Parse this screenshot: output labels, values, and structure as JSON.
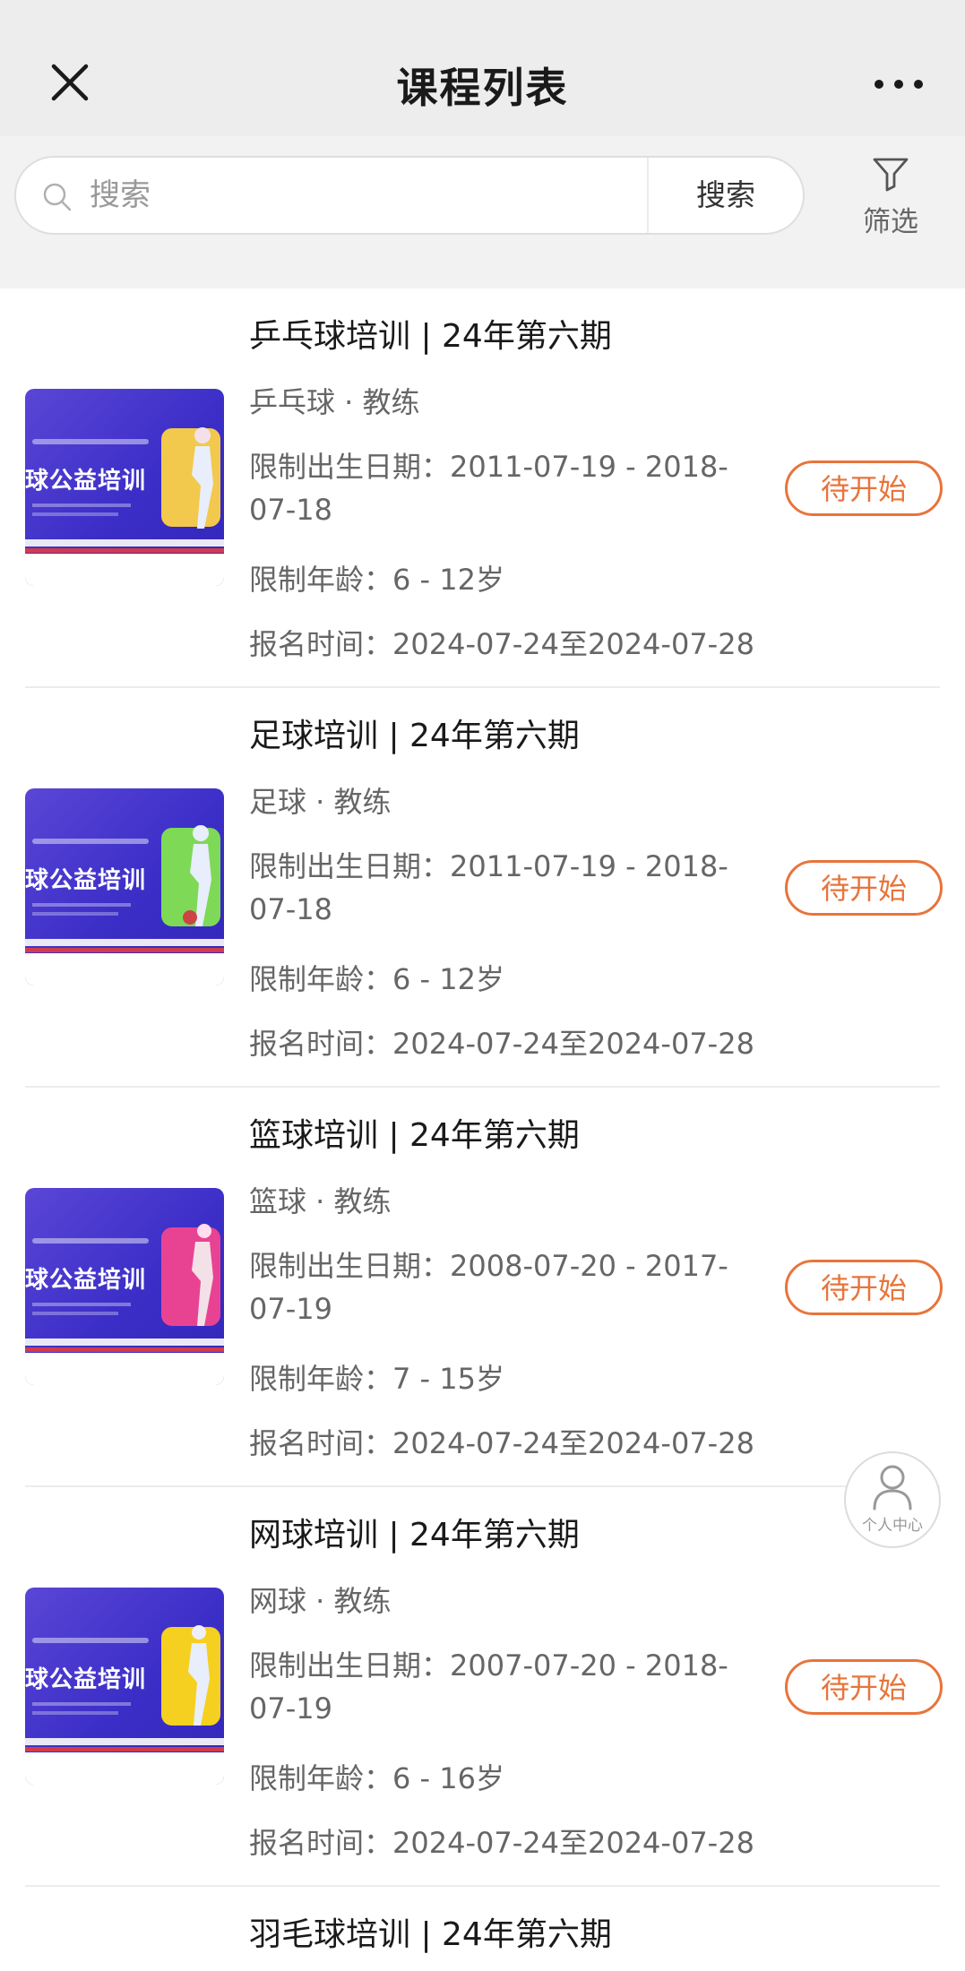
{
  "navbar": {
    "title": "课程列表"
  },
  "search": {
    "placeholder": "搜索",
    "button_label": "搜索",
    "filter_label": "筛选"
  },
  "courses": [
    {
      "title": "乒乓球培训 | 24年第六期",
      "subtitle": "乒乓球 · 教练",
      "birth_line1": "限制出生日期：2011-07-19 - 2018-",
      "birth_line2": "07-18",
      "age": "限制年龄：6 - 12岁",
      "registration": "报名时间：2024-07-24至2024-07-28",
      "status": "待开始",
      "thumb_text": "球公益培训",
      "thumb_accent": "#f2c94c"
    },
    {
      "title": "足球培训 | 24年第六期",
      "subtitle": "足球 · 教练",
      "birth_line1": "限制出生日期：2011-07-19 - 2018-",
      "birth_line2": "07-18",
      "age": "限制年龄：6 - 12岁",
      "registration": "报名时间：2024-07-24至2024-07-28",
      "status": "待开始",
      "thumb_text": "球公益培训",
      "thumb_accent": "#7ed957"
    },
    {
      "title": "篮球培训 | 24年第六期",
      "subtitle": "篮球 · 教练",
      "birth_line1": "限制出生日期：2008-07-20 - 2017-",
      "birth_line2": "07-19",
      "age": "限制年龄：7 - 15岁",
      "registration": "报名时间：2024-07-24至2024-07-28",
      "status": "待开始",
      "thumb_text": "球公益培训",
      "thumb_accent": "#e84393"
    },
    {
      "title": "网球培训 | 24年第六期",
      "subtitle": "网球 · 教练",
      "birth_line1": "限制出生日期：2007-07-20 - 2018-",
      "birth_line2": "07-19",
      "age": "限制年龄：6 - 16岁",
      "registration": "报名时间：2024-07-24至2024-07-28",
      "status": "待开始",
      "thumb_text": "球公益培训",
      "thumb_accent": "#f5d020"
    }
  ],
  "next_item_peek": "羽毛球培训 | 24年第六期",
  "profile_fab": {
    "label": "个人中心"
  },
  "colors": {
    "status_orange": "#e8743b",
    "navbar_bg": "#ededed",
    "thumb_blue": "#3b2ec7"
  }
}
